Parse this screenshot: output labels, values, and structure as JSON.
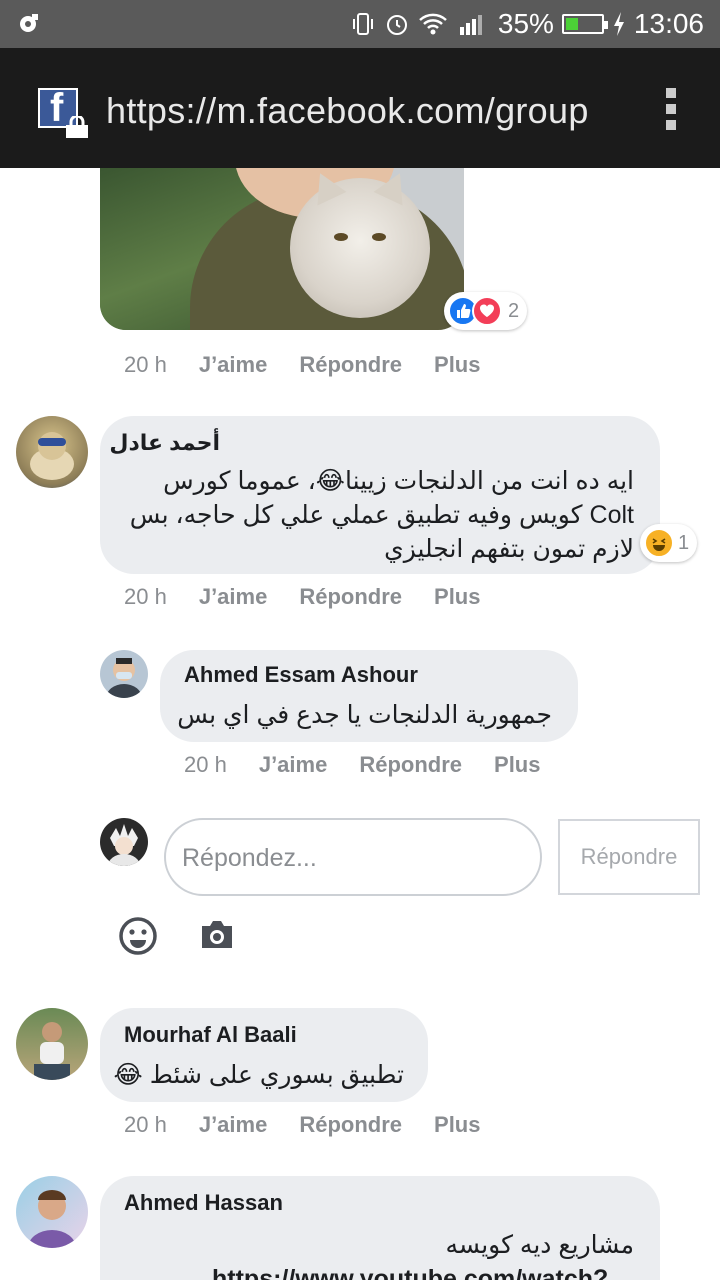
{
  "status_bar": {
    "battery_percent": "35%",
    "battery_level": 0.35,
    "time": "13:06",
    "colors": {
      "background": "#5a5a5a",
      "battery_fill": "#4cd137"
    }
  },
  "browser": {
    "url": "https://m.facebook.com/group",
    "site_icon": "facebook-lock-icon",
    "menu_icon": "overflow-menu-icon"
  },
  "reactions": {
    "post_photo": {
      "count": "2",
      "icons": [
        "like-icon",
        "love-icon"
      ]
    },
    "comment1": {
      "count": "1",
      "icons": [
        "haha-icon"
      ]
    }
  },
  "labels": {
    "like": "J’aime",
    "reply": "Répondre",
    "more": "Plus"
  },
  "comments": [
    {
      "author": "",
      "time": "20 h"
    },
    {
      "author": "أحمد عادل",
      "lines": [
        "ايه ده انت من الدلنجات زيينا😂، عموما كورس",
        "Colt كويس وفيه تطبيق عملي علي كل حاجه، بس",
        "لازم تمون بتفهم انجليزي"
      ],
      "time": "20 h"
    },
    {
      "author": "Ahmed Essam Ashour",
      "lines": [
        "جمهورية الدلنجات يا جدع في اي بس"
      ],
      "time": "20 h"
    },
    {
      "author": "Mourhaf Al Baali",
      "lines": [
        "تطبيق بسوري على شئط 😂"
      ],
      "time": "20 h"
    },
    {
      "author": "Ahmed Hassan",
      "lines": [
        "مشاريع ديه كويسه",
        "https://www.youtube.com/watch?"
      ]
    }
  ],
  "reply_box": {
    "placeholder": "Répondez...",
    "button_label": "Répondre",
    "emoji_icon": "smiley-icon",
    "camera_icon": "camera-icon"
  },
  "colors": {
    "bubble": "#ebedf0",
    "meta_text": "#8a8d91",
    "like_blue": "#1877f2",
    "love_red": "#f33e58",
    "haha_yellow": "#f7b125"
  }
}
